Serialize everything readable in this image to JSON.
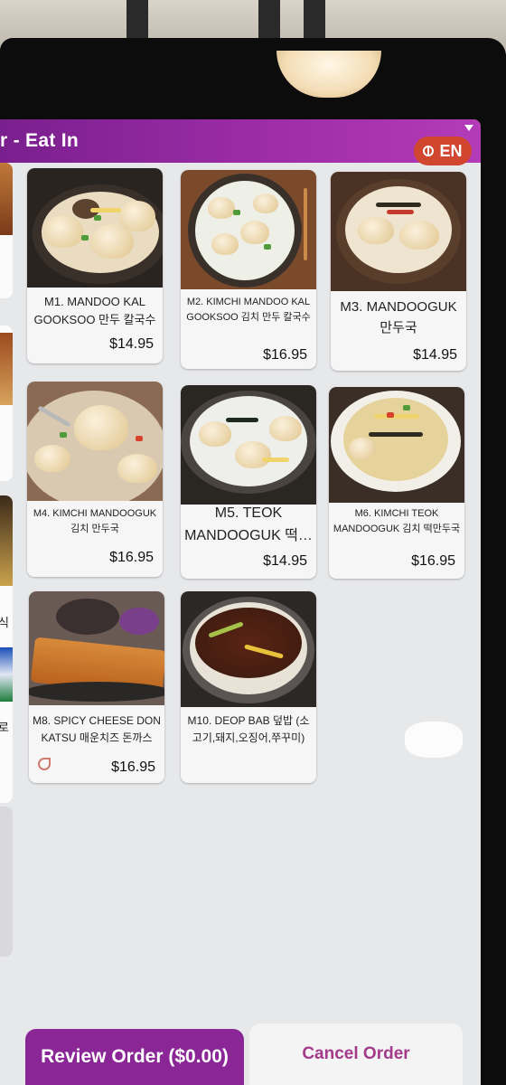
{
  "header": {
    "title": "r - Eat In",
    "language_label": "EN"
  },
  "sidebar": {
    "labels": [
      "식",
      "로"
    ]
  },
  "menu": {
    "items": [
      {
        "name": "M1. MANDOO KAL GOOKSOO 만두 칼국수",
        "price": "$14.95"
      },
      {
        "name": "M2. KIMCHI MANDOO KAL GOOKSOO 김치 만두 칼국수",
        "price": "$16.95"
      },
      {
        "name": "M3. MANDOOGUK 만두국",
        "price": "$14.95"
      },
      {
        "name": "M4. KIMCHI MANDOOGUK 김치 만두국",
        "price": "$16.95"
      },
      {
        "name": "M5. TEOK MANDOOGUK 떡…",
        "price": "$14.95"
      },
      {
        "name": "M6. KIMCHI TEOK MANDOOGUK 김치 떡만두국",
        "price": "$16.95"
      },
      {
        "name": "M8. SPICY CHEESE DON KATSU 매운치즈 돈까스",
        "price": "$16.95"
      },
      {
        "name": "M10. DEOP BAB 덮밥 (소고기,돼지,오징어,쭈꾸미)",
        "price": ""
      }
    ]
  },
  "footer": {
    "review_label": "Review Order ($0.00)",
    "cancel_label": "Cancel Order"
  },
  "colors": {
    "header": "#a02ea9",
    "review_button": "#8a2696",
    "language_button": "#d1462f",
    "cancel_text": "#a33b8a"
  }
}
